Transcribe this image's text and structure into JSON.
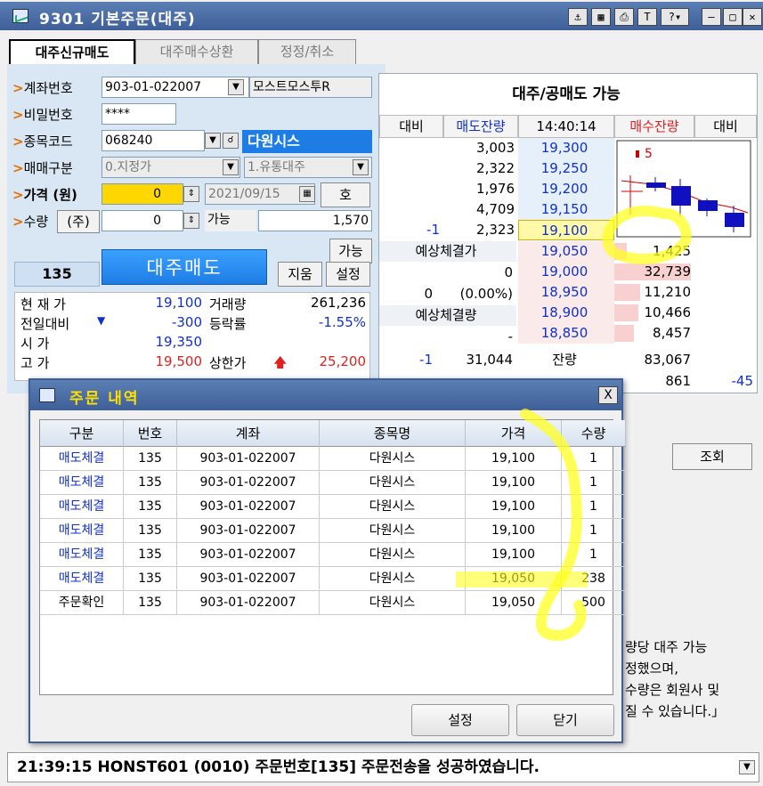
{
  "window": {
    "title": "9301 기본주문(대주)",
    "title_buttons": [
      "♈",
      "▦",
      "⎙",
      "T",
      "?"
    ]
  },
  "tabs": [
    "대주신규매도",
    "대주매수상환",
    "정정/취소"
  ],
  "form": {
    "account_label": "계좌번호",
    "account_value": "903-01-022007",
    "account_name": "모스트모스투R",
    "password_label": "비밀번호",
    "password_value": "****",
    "code_label": "종목코드",
    "code_value": "068240",
    "stock_name": "다원시스",
    "trade_type_label": "매매구분",
    "trade_type_value": "0.지정가",
    "loan_type_value": "1.유통대주",
    "price_label": "가격 (원)",
    "price_value": "0",
    "date_value": "2021/09/15",
    "ho_label": "호",
    "qty_label": "수량",
    "qty_unit": "(주)",
    "qty_value": "0",
    "available_label": "가능",
    "available_value": "1,570",
    "available_btn": "가능",
    "clear_btn": "지움",
    "settings_btn": "설정",
    "order_count": "135",
    "sell_btn": "대주매도"
  },
  "stats": {
    "current_label": "현 재 가",
    "current_value": "19,100",
    "volume_label": "거래량",
    "volume_value": "261,236",
    "change_label": "전일대비",
    "change_value": "-300",
    "rate_label": "등락률",
    "rate_value": "-1.55%",
    "open_label": "시    가",
    "open_value": "19,350",
    "high_label": "고    가",
    "high_value": "19,500",
    "upper_label": "상한가",
    "upper_value": "25,200"
  },
  "book": {
    "title": "대주/공매도 가능",
    "headers": [
      "대비",
      "매도잔량",
      "14:40:14",
      "매수잔량",
      "대비"
    ],
    "ask_rows": [
      {
        "diff": "",
        "qty": "3,003",
        "price": "19,300"
      },
      {
        "diff": "",
        "qty": "2,322",
        "price": "19,250"
      },
      {
        "diff": "",
        "qty": "1,976",
        "price": "19,200"
      },
      {
        "diff": "",
        "qty": "4,709",
        "price": "19,150"
      },
      {
        "diff": "-1",
        "qty": "2,323",
        "price": "19,100"
      }
    ],
    "expected_price_label": "예상체결가",
    "expected_price_value": "0",
    "expected_change": "0",
    "expected_rate": "(0.00%)",
    "expected_qty_label": "예상체결량",
    "expected_qty_value": "-",
    "bid_rows": [
      {
        "price": "19,050",
        "qty": "1,425"
      },
      {
        "price": "19,000",
        "qty": "32,739"
      },
      {
        "price": "18,950",
        "qty": "11,210"
      },
      {
        "price": "18,900",
        "qty": "10,466"
      },
      {
        "price": "18,850",
        "qty": "8,457"
      }
    ],
    "total_ask_diff": "-1",
    "total_ask": "31,044",
    "remain_label": "잔량",
    "total_bid": "83,067",
    "after_bid": "861",
    "after_bid_diff": "-45",
    "candle_label": "5"
  },
  "modal": {
    "title": "주문 내역",
    "close": "X",
    "columns": [
      "구분",
      "번호",
      "계좌",
      "종목명",
      "가격",
      "수량"
    ],
    "rows": [
      [
        "매도체결",
        "135",
        "903-01-022007",
        "다원시스",
        "19,100",
        "1"
      ],
      [
        "매도체결",
        "135",
        "903-01-022007",
        "다원시스",
        "19,100",
        "1"
      ],
      [
        "매도체결",
        "135",
        "903-01-022007",
        "다원시스",
        "19,100",
        "1"
      ],
      [
        "매도체결",
        "135",
        "903-01-022007",
        "다원시스",
        "19,100",
        "1"
      ],
      [
        "매도체결",
        "135",
        "903-01-022007",
        "다원시스",
        "19,100",
        "1"
      ],
      [
        "매도체결",
        "135",
        "903-01-022007",
        "다원시스",
        "19,050",
        "238"
      ],
      [
        "주문확인",
        "135",
        "903-01-022007",
        "다원시스",
        "19,050",
        "500"
      ]
    ],
    "settings_btn": "설정",
    "close_btn": "닫기"
  },
  "side": {
    "query_btn": "조회",
    "notice_lines": [
      "량당 대주 가능",
      "정했으며,",
      "수량은 회원사 및",
      "질 수 있습니다.」"
    ]
  },
  "status": {
    "message": "21:39:15 HONST601 (0010) 주문번호[135] 주문전송을 성공하였습니다."
  },
  "colors": {
    "title_bg": "#3e5f97",
    "accent_blue": "#1e7de4",
    "sell_red": "#e02020",
    "bid_bar": "#f9d0d0",
    "highlight": "#ffff3c"
  }
}
